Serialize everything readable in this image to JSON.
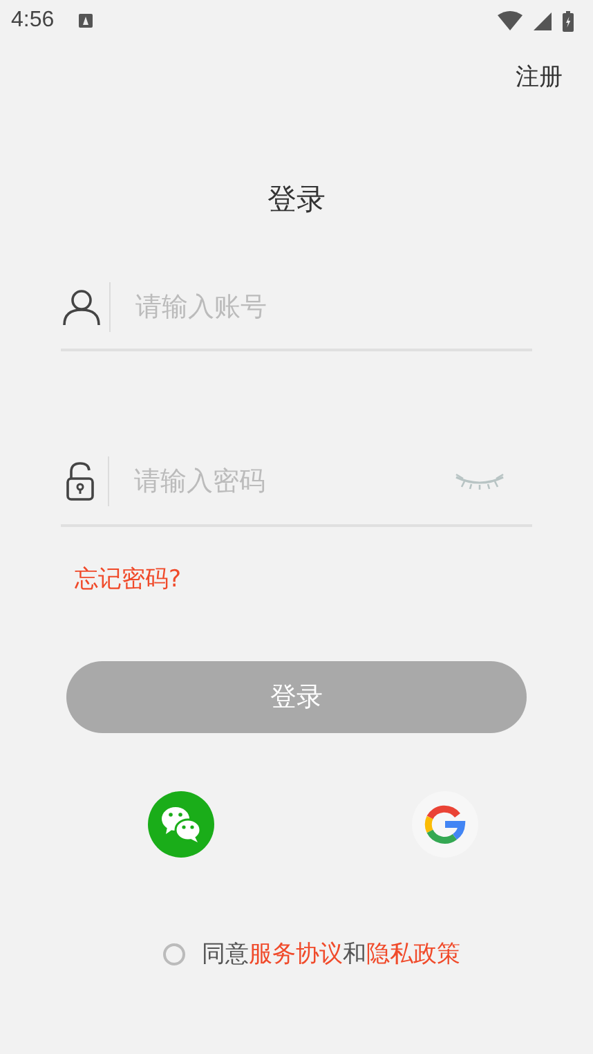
{
  "status_bar": {
    "time": "4:56"
  },
  "header": {
    "register": "注册"
  },
  "title": "登录",
  "fields": [
    {
      "kind": "account",
      "placeholder": "请输入账号"
    },
    {
      "kind": "password",
      "placeholder": "请输入密码"
    }
  ],
  "forgot_password": "忘记密码?",
  "login_button": {
    "label": "登录",
    "disabled": true
  },
  "social": [
    {
      "kind": "wechat"
    },
    {
      "kind": "google"
    }
  ],
  "agreement": {
    "checked": false,
    "parts": [
      {
        "kind": "text",
        "text": "同意"
      },
      {
        "kind": "link",
        "text": "服务协议"
      },
      {
        "kind": "text",
        "text": "和"
      },
      {
        "kind": "link",
        "text": "隐私政策"
      }
    ]
  }
}
